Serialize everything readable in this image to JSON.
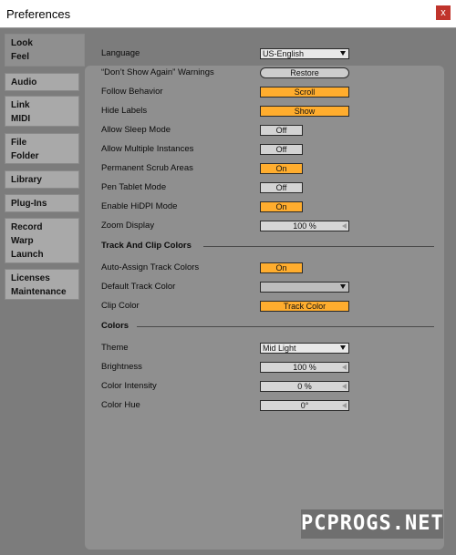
{
  "window": {
    "title": "Preferences",
    "close_glyph": "x"
  },
  "sidebar": {
    "tabs": [
      {
        "lines": [
          "Look",
          "Feel"
        ]
      },
      {
        "lines": [
          "Audio"
        ]
      },
      {
        "lines": [
          "Link",
          "MIDI"
        ]
      },
      {
        "lines": [
          "File",
          "Folder"
        ]
      },
      {
        "lines": [
          "Library"
        ]
      },
      {
        "lines": [
          "Plug-Ins"
        ]
      },
      {
        "lines": [
          "Record",
          "Warp",
          "Launch"
        ]
      },
      {
        "lines": [
          "Licenses",
          "Maintenance"
        ]
      }
    ]
  },
  "settings": {
    "language": {
      "label": "Language",
      "value": "US-English"
    },
    "dont_show_again": {
      "label": "“Don’t Show Again” Warnings",
      "value": "Restore"
    },
    "follow_behavior": {
      "label": "Follow Behavior",
      "value": "Scroll"
    },
    "hide_labels": {
      "label": "Hide Labels",
      "value": "Show"
    },
    "allow_sleep_mode": {
      "label": "Allow Sleep Mode",
      "value": "Off"
    },
    "allow_multiple_instances": {
      "label": "Allow Multiple Instances",
      "value": "Off"
    },
    "permanent_scrub_areas": {
      "label": "Permanent Scrub Areas",
      "value": "On"
    },
    "pen_tablet_mode": {
      "label": "Pen Tablet Mode",
      "value": "Off"
    },
    "enable_hidpi_mode": {
      "label": "Enable HiDPI Mode",
      "value": "On"
    },
    "zoom_display": {
      "label": "Zoom Display",
      "value": "100 %"
    }
  },
  "track_clip_colors": {
    "heading": "Track And Clip Colors",
    "auto_assign": {
      "label": "Auto-Assign Track Colors",
      "value": "On"
    },
    "default_track_color": {
      "label": "Default Track Color",
      "value": ""
    },
    "clip_color": {
      "label": "Clip Color",
      "value": "Track Color"
    }
  },
  "colors": {
    "heading": "Colors",
    "theme": {
      "label": "Theme",
      "value": "Mid Light"
    },
    "brightness": {
      "label": "Brightness",
      "value": "100 %"
    },
    "color_intensity": {
      "label": "Color Intensity",
      "value": "0 %"
    },
    "color_hue": {
      "label": "Color Hue",
      "value": "0°"
    }
  },
  "watermark": "PCPROGS.NET",
  "style_colors": {
    "accent_on": "#ffad2e",
    "off": "#d3d3d3",
    "panel": "#8f8f8f",
    "background": "#7c7c7c"
  }
}
